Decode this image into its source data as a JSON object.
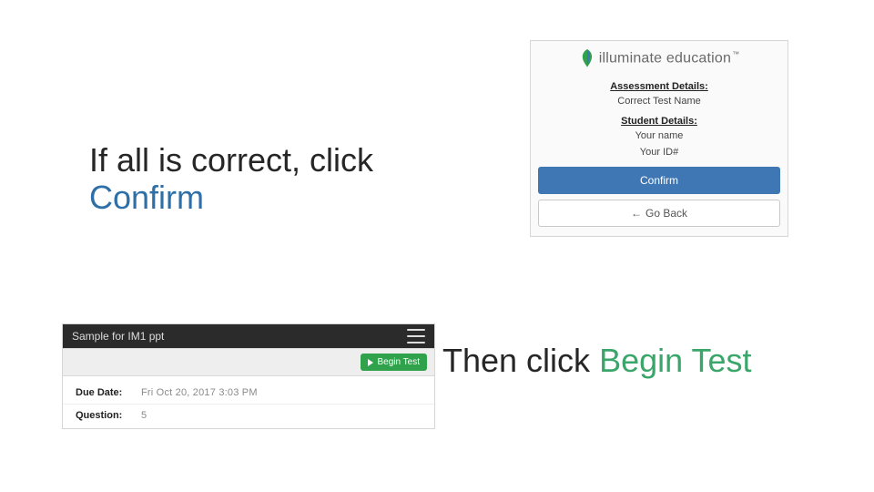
{
  "instructions": {
    "line1_prefix": "If all is correct, click",
    "line1_action": "Confirm",
    "line2_prefix": "Then click ",
    "line2_action": "Begin Test"
  },
  "confirm_panel": {
    "brand_name": "illuminate education",
    "brand_tm": "™",
    "section_assessment_heading": "Assessment Details:",
    "assessment_value": "Correct Test Name",
    "section_student_heading": "Student Details:",
    "student_name": "Your name",
    "student_id": "Your ID#",
    "confirm_label": "Confirm",
    "goback_label": "Go Back",
    "icons": {
      "leaf": "leaf-icon",
      "back_arrow": "arrow-left-icon"
    },
    "colors": {
      "confirm_bg": "#3f77b4",
      "confirm_text": "#ffffff"
    }
  },
  "begin_panel": {
    "title": "Sample for IM1 ppt",
    "menu_icon": "hamburger-icon",
    "begin_label": "Begin Test",
    "rows": {
      "due_label": "Due Date:",
      "due_value": "Fri Oct 20, 2017 3:03 PM",
      "question_label": "Question:",
      "question_value": "5"
    },
    "colors": {
      "header_bg": "#2b2b2b",
      "begin_bg": "#2fa24b"
    }
  }
}
